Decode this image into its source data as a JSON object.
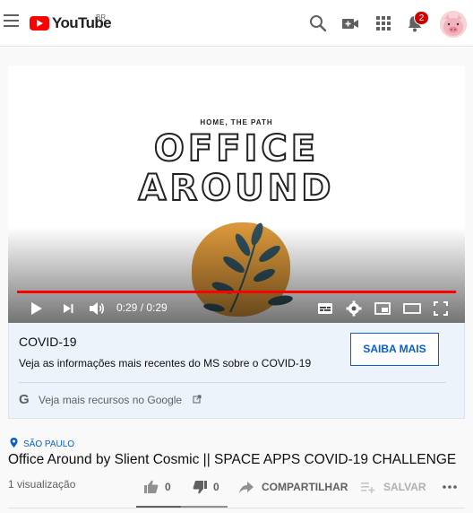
{
  "header": {
    "logo_text": "YouTube",
    "region": "BR",
    "notifications_count": "2",
    "icons": [
      "menu-icon",
      "search-icon",
      "video-camera-icon",
      "apps-grid-icon",
      "bell-icon"
    ]
  },
  "player": {
    "thumbnail": {
      "subtitle": "HOME, THE PATH",
      "title_line1": "OFFICE",
      "title_line2": "AROUND"
    },
    "time_display": "0:29 / 0:29",
    "progress_fraction": 1.0,
    "controls": [
      "play-icon",
      "next-icon",
      "volume-icon",
      "subtitles-icon",
      "settings-icon",
      "miniplayer-icon",
      "theater-icon",
      "fullscreen-icon"
    ]
  },
  "info_panel": {
    "title": "COVID-19",
    "description": "Veja as informações mais recentes do MS sobre o COVID-19",
    "button_label": "SAIBA MAIS",
    "google_link": "Veja mais recursos no Google"
  },
  "video": {
    "location": "SÃO PAULO",
    "title": "Office Around by Slient Cosmic || SPACE APPS COVID-19 CHALLENGE",
    "views": "1 visualização",
    "likes": "0",
    "dislikes": "0",
    "share_label": "COMPARTILHAR",
    "save_label": "SALVAR"
  },
  "colors": {
    "brand_red": "#ff0000",
    "link_blue": "#065fd4",
    "panel_bg": "#edf3fb"
  }
}
